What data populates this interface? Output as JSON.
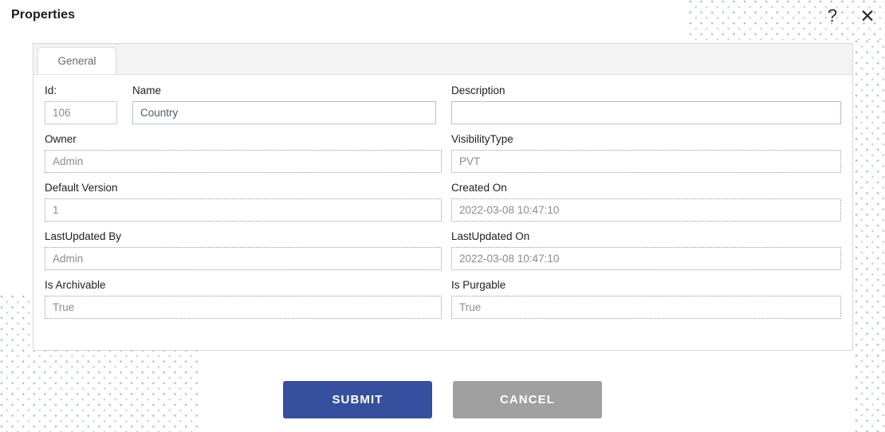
{
  "header": {
    "title": "Properties",
    "help_icon": "question-mark-icon",
    "close_icon": "close-x-icon",
    "help_glyph": "?",
    "close_glyph": "✕"
  },
  "panel": {
    "tabs": [
      {
        "label": "General",
        "active": true
      }
    ]
  },
  "form": {
    "fields": {
      "id": {
        "label": "Id:",
        "value": "106",
        "disabled": true
      },
      "name": {
        "label": "Name",
        "value": "Country",
        "disabled": false
      },
      "description": {
        "label": "Description",
        "value": "",
        "disabled": false
      },
      "owner": {
        "label": "Owner",
        "value": "Admin",
        "disabled": true
      },
      "visibility": {
        "label": "VisibilityType",
        "value": "PVT",
        "disabled": true
      },
      "default_version": {
        "label": "Default Version",
        "value": "1",
        "disabled": true
      },
      "created_on": {
        "label": "Created On",
        "value": "2022-03-08 10:47:10",
        "disabled": true
      },
      "lastupdated_by": {
        "label": "LastUpdated By",
        "value": "Admin",
        "disabled": true
      },
      "lastupdated_on": {
        "label": "LastUpdated On",
        "value": "2022-03-08 10:47:10",
        "disabled": true
      },
      "is_archivable": {
        "label": "Is Archivable",
        "value": "True",
        "disabled": true
      },
      "is_purgable": {
        "label": "Is Purgable",
        "value": "True",
        "disabled": true
      }
    }
  },
  "footer": {
    "submit_label": "SUBMIT",
    "cancel_label": "CANCEL"
  },
  "colors": {
    "submit_blue": "#36509f",
    "cancel_gray": "#a0a0a0",
    "pattern_dot": "#a9b3e2",
    "panel_border": "#d6d6d6",
    "tabbar_bg": "#f3f3f3"
  }
}
